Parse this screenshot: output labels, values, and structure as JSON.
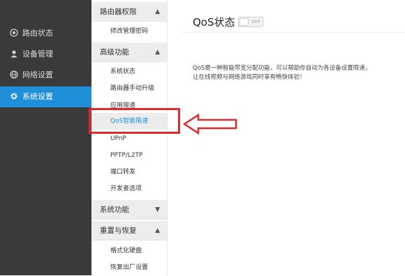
{
  "sidebar": {
    "items": [
      {
        "label": "路由状态",
        "icon": "globe-icon"
      },
      {
        "label": "设备管理",
        "icon": "user-icon"
      },
      {
        "label": "网络设置",
        "icon": "globe-icon"
      },
      {
        "label": "系统设置",
        "icon": "gear-icon",
        "active": true
      }
    ]
  },
  "submenu": {
    "groups": [
      {
        "label": "路由器权限",
        "chevron": "up",
        "items": [
          {
            "label": "修改管理密码"
          }
        ]
      },
      {
        "label": "高级功能",
        "chevron": "up",
        "items": [
          {
            "label": "系统状态"
          },
          {
            "label": "路由器手动升级"
          },
          {
            "label": "应用限速"
          },
          {
            "label": "QoS智能限速",
            "active": true
          },
          {
            "label": "UPnP"
          },
          {
            "label": "PPTP/L2TP"
          },
          {
            "label": "端口转发"
          },
          {
            "label": "开发者选项"
          }
        ]
      },
      {
        "label": "系统功能",
        "chevron": "down",
        "items": []
      },
      {
        "label": "重置与恢复",
        "chevron": "up",
        "items": [
          {
            "label": "格式化硬盘"
          },
          {
            "label": "恢复出厂设置"
          }
        ]
      }
    ]
  },
  "content": {
    "title": "QoS状态",
    "toggle_label": "OFF",
    "toggle_on": false,
    "description": [
      "QoS是一种智能带宽分配功能，可以帮助你自动为各设备设置限速，",
      "让在线视频与网络游戏同时享有畅快体验！"
    ]
  },
  "colors": {
    "accent": "#1e8fd8",
    "sidebar_bg": "#3a3a3a",
    "annotation_red": "#e02a2a"
  }
}
